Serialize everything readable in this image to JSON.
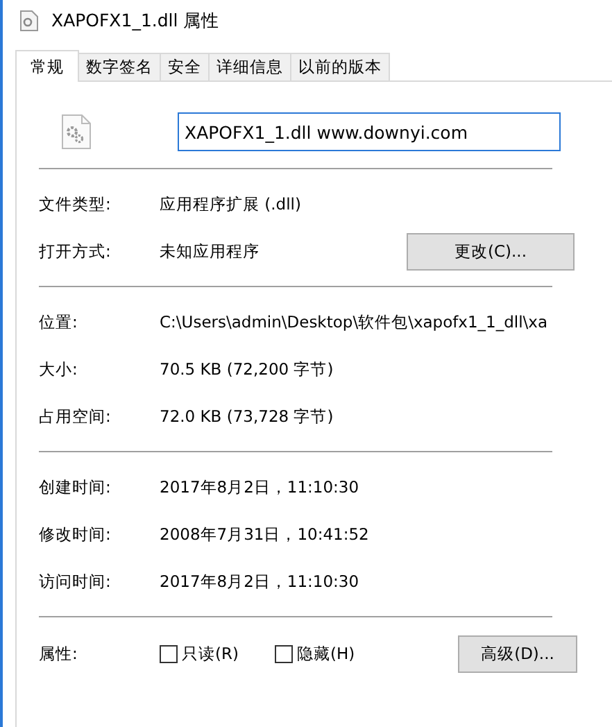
{
  "window": {
    "title": "XAPOFX1_1.dll 属性"
  },
  "tabs": [
    {
      "label": "常规",
      "selected": true
    },
    {
      "label": "数字签名",
      "selected": false
    },
    {
      "label": "安全",
      "selected": false
    },
    {
      "label": "详细信息",
      "selected": false
    },
    {
      "label": "以前的版本",
      "selected": false
    }
  ],
  "file_name": {
    "value": "XAPOFX1_1.dll www.downyi.com"
  },
  "groups": [
    [
      {
        "label": "文件类型:",
        "value": "应用程序扩展 (.dll)"
      },
      {
        "label": "打开方式:",
        "value": "未知应用程序",
        "button": "更改(C)..."
      }
    ],
    [
      {
        "label": "位置:",
        "value": "C:\\Users\\admin\\Desktop\\软件包\\xapofx1_1_dll\\xa"
      },
      {
        "label": "大小:",
        "value": "70.5 KB (72,200 字节)"
      },
      {
        "label": "占用空间:",
        "value": "72.0 KB (73,728 字节)"
      }
    ],
    [
      {
        "label": "创建时间:",
        "value": "2017年8月2日，11:10:30"
      },
      {
        "label": "修改时间:",
        "value": "2008年7月31日，10:41:52"
      },
      {
        "label": "访问时间:",
        "value": "2017年8月2日，11:10:30"
      }
    ]
  ],
  "attributes": {
    "label": "属性:",
    "checkboxes": [
      {
        "label": "只读(R)",
        "checked": false
      },
      {
        "label": "隐藏(H)",
        "checked": false
      }
    ],
    "button": "高级(D)..."
  }
}
